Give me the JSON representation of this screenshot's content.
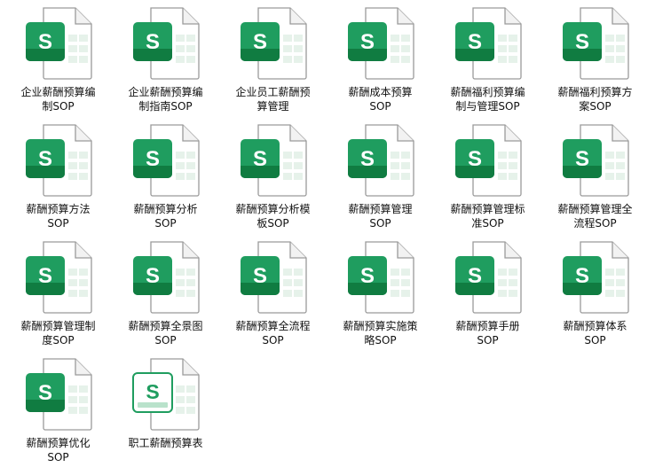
{
  "colors": {
    "accent": "#1f9d5f",
    "accent_dark": "#107c41",
    "text": "#111111"
  },
  "files": [
    {
      "label": "企业薪酬预算编\n制SOP",
      "icon": "spreadsheet-app-icon",
      "style": "solid"
    },
    {
      "label": "企业薪酬预算编\n制指南SOP",
      "icon": "spreadsheet-app-icon",
      "style": "solid"
    },
    {
      "label": "企业员工薪酬预\n算管理",
      "icon": "spreadsheet-app-icon",
      "style": "solid"
    },
    {
      "label": "薪酬成本预算\nSOP",
      "icon": "spreadsheet-app-icon",
      "style": "solid"
    },
    {
      "label": "薪酬福利预算编\n制与管理SOP",
      "icon": "spreadsheet-app-icon",
      "style": "solid"
    },
    {
      "label": "薪酬福利预算方\n案SOP",
      "icon": "spreadsheet-app-icon",
      "style": "solid"
    },
    {
      "label": "薪酬预算方法\nSOP",
      "icon": "spreadsheet-app-icon",
      "style": "solid"
    },
    {
      "label": "薪酬预算分析\nSOP",
      "icon": "spreadsheet-app-icon",
      "style": "solid"
    },
    {
      "label": "薪酬预算分析模\n板SOP",
      "icon": "spreadsheet-app-icon",
      "style": "solid"
    },
    {
      "label": "薪酬预算管理\nSOP",
      "icon": "spreadsheet-app-icon",
      "style": "solid"
    },
    {
      "label": "薪酬预算管理标\n准SOP",
      "icon": "spreadsheet-app-icon",
      "style": "solid"
    },
    {
      "label": "薪酬预算管理全\n流程SOP",
      "icon": "spreadsheet-app-icon",
      "style": "solid"
    },
    {
      "label": "薪酬预算管理制\n度SOP",
      "icon": "spreadsheet-app-icon",
      "style": "solid"
    },
    {
      "label": "薪酬预算全景图\nSOP",
      "icon": "spreadsheet-app-icon",
      "style": "solid"
    },
    {
      "label": "薪酬预算全流程\nSOP",
      "icon": "spreadsheet-app-icon",
      "style": "solid"
    },
    {
      "label": "薪酬预算实施策\n略SOP",
      "icon": "spreadsheet-app-icon",
      "style": "solid"
    },
    {
      "label": "薪酬预算手册\nSOP",
      "icon": "spreadsheet-app-icon",
      "style": "solid"
    },
    {
      "label": "薪酬预算体系\nSOP",
      "icon": "spreadsheet-app-icon",
      "style": "solid"
    },
    {
      "label": "薪酬预算优化\nSOP",
      "icon": "spreadsheet-app-icon",
      "style": "solid"
    },
    {
      "label": "职工薪酬预算表",
      "icon": "spreadsheet-app-icon",
      "style": "outline"
    }
  ]
}
